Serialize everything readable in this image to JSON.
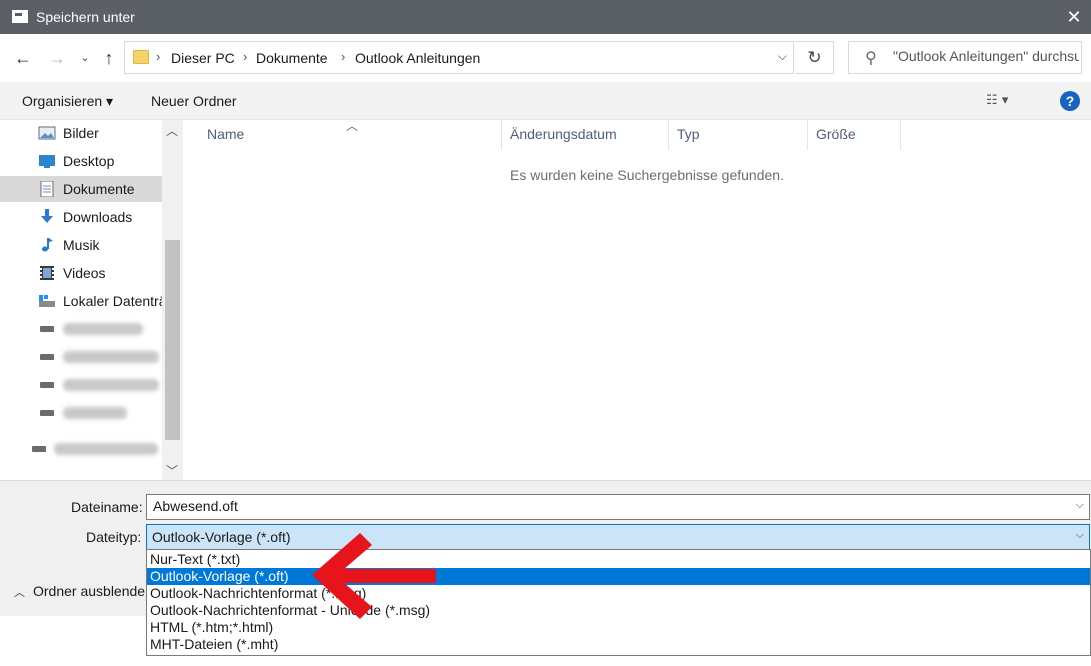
{
  "window": {
    "title": "Speichern unter",
    "close_glyph": "✕"
  },
  "address": {
    "breadcrumbs": [
      "Dieser PC",
      "Dokumente",
      "Outlook Anleitungen"
    ],
    "search_placeholder": "\"Outlook Anleitungen\" durchsuchen"
  },
  "toolbar": {
    "organize_label": "Organisieren ▾",
    "new_folder_label": "Neuer Ordner"
  },
  "nav": {
    "items": [
      {
        "label": "Bilder",
        "icon": "pictures-icon"
      },
      {
        "label": "Desktop",
        "icon": "desktop-icon"
      },
      {
        "label": "Dokumente",
        "icon": "documents-icon",
        "selected": true
      },
      {
        "label": "Downloads",
        "icon": "downloads-icon"
      },
      {
        "label": "Musik",
        "icon": "music-icon"
      },
      {
        "label": "Videos",
        "icon": "videos-icon"
      },
      {
        "label": "Lokaler Datenträger",
        "icon": "local-drive-icon"
      }
    ]
  },
  "filelist": {
    "columns": [
      "Name",
      "Änderungsdatum",
      "Typ",
      "Größe"
    ],
    "empty_message": "Es wurden keine Suchergebnisse gefunden."
  },
  "save": {
    "filename_label": "Dateiname:",
    "filename_value": "Abwesend.oft",
    "filetype_label": "Dateityp:",
    "filetype_value": "Outlook-Vorlage (*.oft)",
    "hide_folders_label": "Ordner ausblenden"
  },
  "filetype_options": [
    {
      "label": "Nur-Text (*.txt)",
      "selected": false
    },
    {
      "label": "Outlook-Vorlage (*.oft)",
      "selected": true
    },
    {
      "label": "Outlook-Nachrichtenformat (*.msg)",
      "selected": false
    },
    {
      "label": "Outlook-Nachrichtenformat - Unicode (*.msg)",
      "selected": false
    },
    {
      "label": "HTML (*.htm;*.html)",
      "selected": false
    },
    {
      "label": "MHT-Dateien (*.mht)",
      "selected": false
    }
  ],
  "colors": {
    "accent": "#0078d7",
    "annotation_arrow": "#e8141c",
    "titlebar": "#5b5f66"
  }
}
